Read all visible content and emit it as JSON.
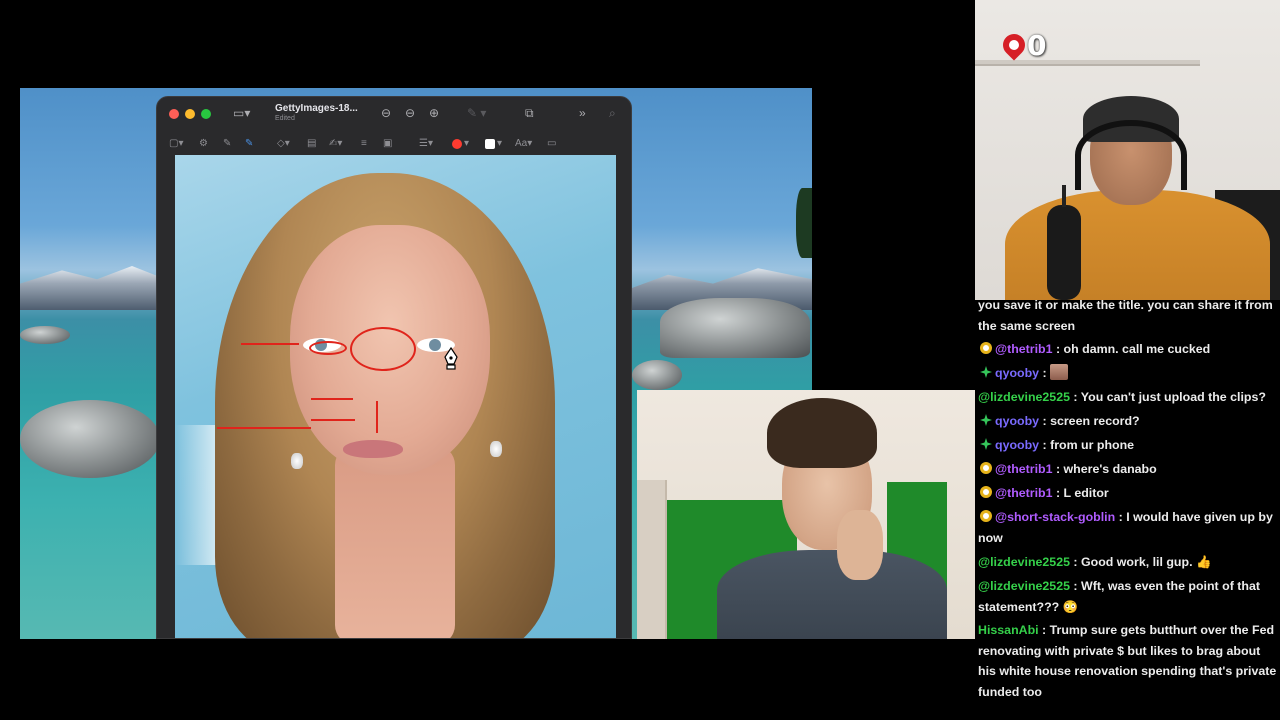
{
  "preview": {
    "doc_title": "GettyImages-18...",
    "doc_subtitle": "Edited"
  },
  "streamer_cam": {
    "counter_value": "0"
  },
  "chat": {
    "messages": [
      {
        "user": "",
        "text": "you save it or make the title. you can share it from the same screen",
        "user_color": "#ececec",
        "badge": "none"
      },
      {
        "user": "@thetrib1",
        "text": "oh damn. call me cucked",
        "user_color": "#b05cff",
        "badge": "sub"
      },
      {
        "user": "qyooby",
        "text": "",
        "user_color": "#7a6bff",
        "badge": "prime",
        "emote": "face-emote"
      },
      {
        "user": "@lizdevine2525",
        "text": "You can't just upload the clips?",
        "user_color": "#35d04a",
        "badge": "none"
      },
      {
        "user": "qyooby",
        "text": "screen record?",
        "user_color": "#7a6bff",
        "badge": "prime"
      },
      {
        "user": "qyooby",
        "text": "from ur phone",
        "user_color": "#7a6bff",
        "badge": "prime"
      },
      {
        "user": "@thetrib1",
        "text": "where's danabo",
        "user_color": "#b05cff",
        "badge": "sub"
      },
      {
        "user": "@thetrib1",
        "text": "L editor",
        "user_color": "#b05cff",
        "badge": "sub"
      },
      {
        "user": "@short-stack-goblin",
        "text": "I would have given up by now",
        "user_color": "#b05cff",
        "badge": "sub"
      },
      {
        "user": "@lizdevine2525",
        "text": "Good work, lil gup. 👍",
        "user_color": "#35d04a",
        "badge": "none"
      },
      {
        "user": "@lizdevine2525",
        "text": "Wft, was even the point of that statement??? 😳",
        "user_color": "#35d04a",
        "badge": "none"
      },
      {
        "user": "HissanAbi",
        "text": "Trump sure gets butthurt over the Fed renovating with private $ but likes to brag about his white house renovation spending that's private funded too",
        "user_color": "#35d04a",
        "badge": "none"
      }
    ]
  },
  "colors": {
    "annotation_red": "#e0241b",
    "chat_text": "#ececec"
  }
}
